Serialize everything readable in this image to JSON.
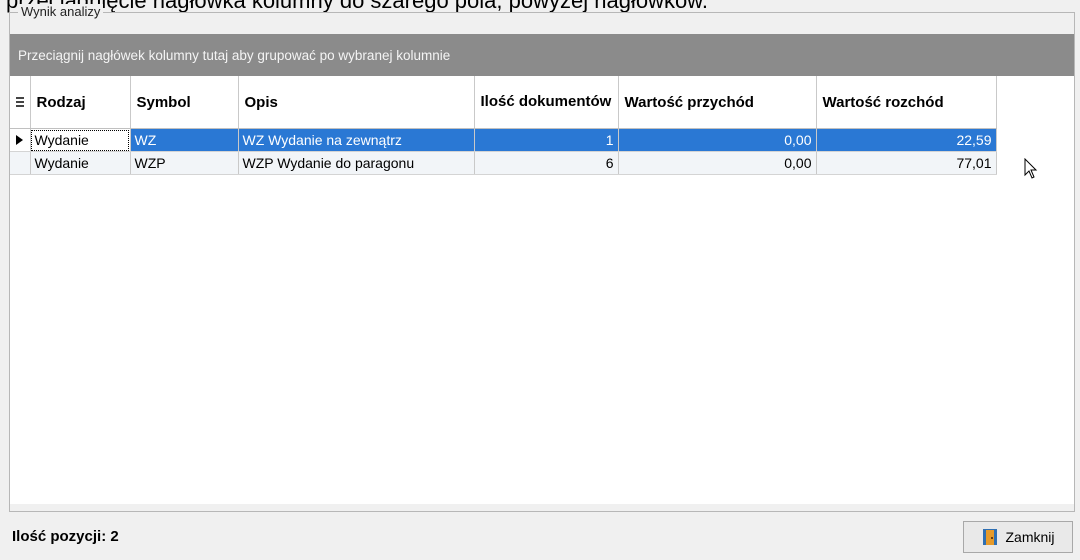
{
  "document_line": "przeciągnięcie nagłówka kolumny do szarego pola, powyżej nagłówków.",
  "groupbox": {
    "title": "Wynik analizy"
  },
  "group_panel": {
    "hint": "Przeciągnij nagłówek kolumny tutaj aby grupować po wybranej kolumnie"
  },
  "table": {
    "columns": [
      "Rodzaj",
      "Symbol",
      "Opis",
      "Ilość dokumentów",
      "Wartość przychód",
      "Wartość rozchód"
    ],
    "rows": [
      {
        "rodzaj": "Wydanie",
        "symbol": "WZ",
        "opis": "WZ  Wydanie na zewnątrz",
        "ilosc": "1",
        "przychod": "0,00",
        "rozchod": "22,59"
      },
      {
        "rodzaj": "Wydanie",
        "symbol": "WZP",
        "opis": "WZP Wydanie do paragonu",
        "ilosc": "6",
        "przychod": "0,00",
        "rozchod": "77,01"
      }
    ],
    "selected_row": 0
  },
  "status": {
    "count_label": "Ilość pozycji: 2"
  },
  "buttons": {
    "close_label": "Zamknij"
  },
  "colors": {
    "selection": "#2a78d4",
    "group_panel": "#8b8b8b"
  },
  "icons": [
    "column-chooser-icon",
    "row-indicator-icon",
    "door-icon",
    "mouse-cursor-icon"
  ]
}
